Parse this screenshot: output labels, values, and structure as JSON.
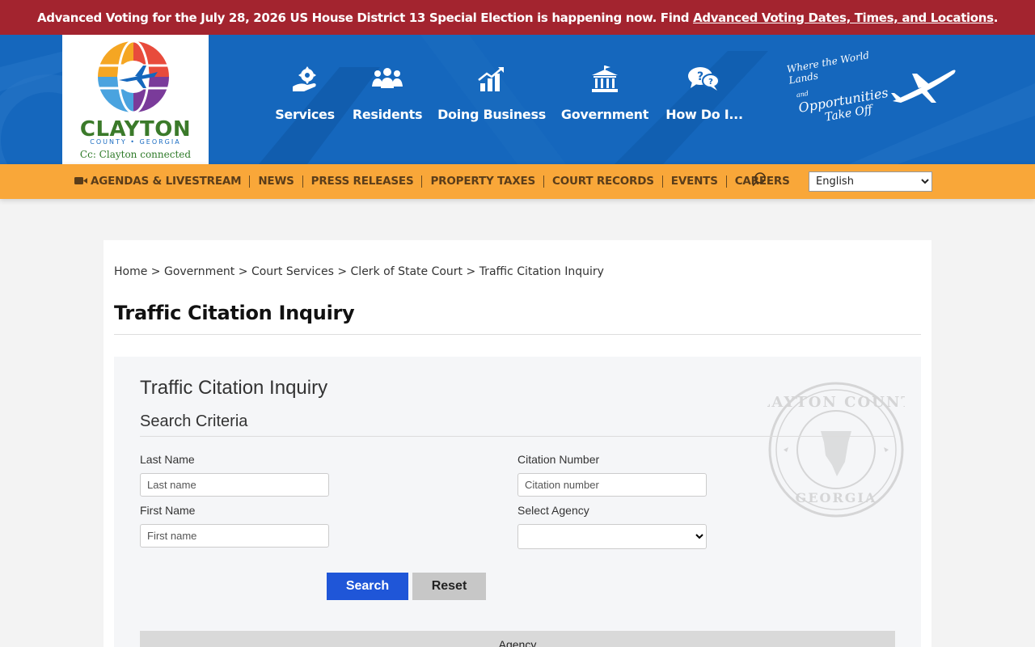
{
  "alert": {
    "text": "Advanced Voting for the July 28, 2026 US House District 13 Special Election is happening now. Find ",
    "link": "Advanced Voting Dates, Times, and Locations",
    "end": "."
  },
  "logo": {
    "name": "CLAYTON",
    "sub": "COUNTY • GEORGIA",
    "tagline": "Cc: Clayton connected"
  },
  "main_nav": [
    {
      "label": "Services",
      "icon": "gear-hand-icon"
    },
    {
      "label": "Residents",
      "icon": "people-icon"
    },
    {
      "label": "Doing Business",
      "icon": "chart-icon"
    },
    {
      "label": "Government",
      "icon": "capitol-icon"
    },
    {
      "label": "How Do I...",
      "icon": "question-chat-icon"
    }
  ],
  "tagline": {
    "line1": "Where the World Lands",
    "line2a": "and",
    "line2b": "Opportunities",
    "line3": "Take Off"
  },
  "sub_nav": [
    "AGENDAS & LIVESTREAM",
    "NEWS",
    "PRESS RELEASES",
    "PROPERTY TAXES",
    "COURT RECORDS",
    "EVENTS",
    "CAREERS"
  ],
  "language": {
    "selected": "English"
  },
  "breadcrumb": [
    "Home",
    "Government",
    "Court Services",
    "Clerk of State Court",
    "Traffic Citation Inquiry"
  ],
  "page_title": "Traffic Citation Inquiry",
  "panel": {
    "title": "Traffic Citation Inquiry",
    "subtitle": "Search Criteria",
    "last_name_label": "Last Name",
    "last_name_placeholder": "Last name",
    "first_name_label": "First Name",
    "first_name_placeholder": "First name",
    "citation_label": "Citation Number",
    "citation_placeholder": "Citation number",
    "agency_label": "Select Agency",
    "agency_value": "",
    "search_button": "Search",
    "reset_button": "Reset",
    "table_header": "Agency"
  },
  "colors": {
    "alert": "#a3242f",
    "header": "#1567bd",
    "subbar": "#f9a739",
    "search_button": "#1f56d8"
  }
}
